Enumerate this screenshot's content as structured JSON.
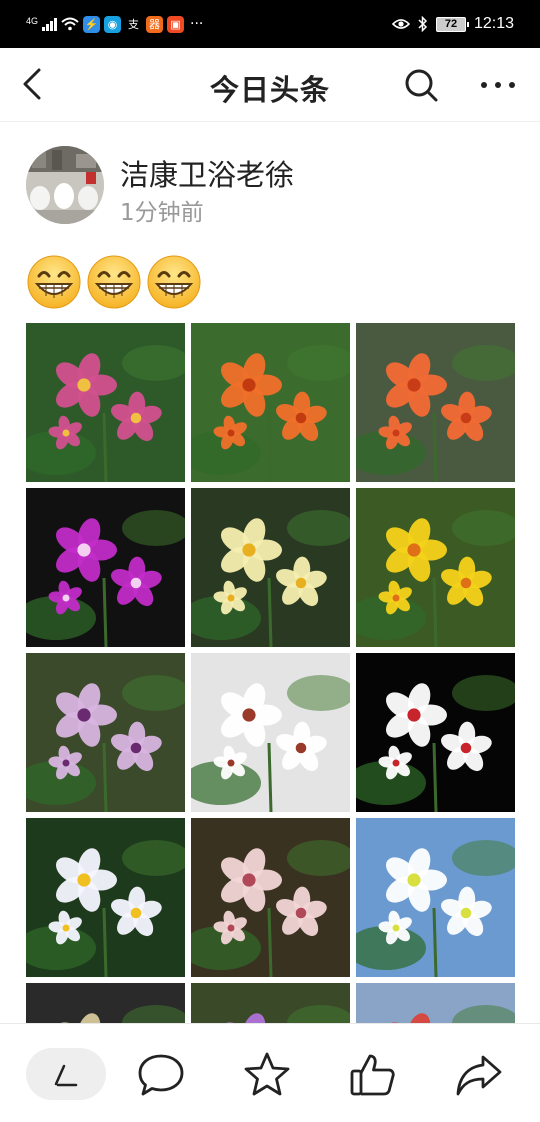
{
  "status_bar": {
    "network": "4G",
    "time": "12:13",
    "battery": "72",
    "overflow": "···",
    "app_icons": [
      {
        "name": "wifi-speed-icon",
        "glyph": "⚡",
        "color": "#2f8fe8"
      },
      {
        "name": "wechat-icon",
        "glyph": "◉",
        "color": "#18a0e0"
      },
      {
        "name": "alipay-icon",
        "glyph": "支",
        "color": "#000000"
      },
      {
        "name": "app-orange-icon",
        "glyph": "器",
        "color": "#f26a1b"
      },
      {
        "name": "app-red-icon",
        "glyph": "▣",
        "color": "#f04a24"
      }
    ]
  },
  "nav": {
    "title": "今日头条"
  },
  "author": {
    "name": "洁康卫浴老徐",
    "time": "1分钟前"
  },
  "post": {
    "emoji": "😁😁😁"
  },
  "gallery": {
    "tiles": [
      {
        "name": "photo-pink-abutilon",
        "bg": "#2e5a2a",
        "flower": "#d2508e",
        "center": "#f0c040"
      },
      {
        "name": "photo-orange-bell-abutilon",
        "bg": "#3c6b2e",
        "flower": "#f0702a",
        "center": "#c23a10"
      },
      {
        "name": "photo-orange-lanterns",
        "bg": "#4a5a40",
        "flower": "#f26a34",
        "center": "#c83c18"
      },
      {
        "name": "photo-magenta-orchid",
        "bg": "#111111",
        "flower": "#c22cc8",
        "center": "#f4d0f0"
      },
      {
        "name": "photo-yellow-zephyranthes",
        "bg": "#2a3a22",
        "flower": "#f6eeb0",
        "center": "#e8b020"
      },
      {
        "name": "photo-yellow-allamanda",
        "bg": "#3b5a24",
        "flower": "#f6d21a",
        "center": "#e07018"
      },
      {
        "name": "photo-passion-flower",
        "bg": "#3a4a2a",
        "flower": "#d8b4e0",
        "center": "#6a2a70"
      },
      {
        "name": "photo-white-spotted-orchid",
        "bg": "#e4e4e4",
        "flower": "#ffffff",
        "center": "#9a3a2a"
      },
      {
        "name": "photo-red-white-orchid",
        "bg": "#050505",
        "flower": "#ffffff",
        "center": "#c8242c"
      },
      {
        "name": "photo-white-iris",
        "bg": "#1e3a1c",
        "flower": "#f6f6ff",
        "center": "#f0c020"
      },
      {
        "name": "photo-pink-slipper-orchid",
        "bg": "#3a3220",
        "flower": "#f2d6d6",
        "center": "#b04858"
      },
      {
        "name": "photo-white-lily-sky",
        "bg": "#6a9ad0",
        "flower": "#ffffff",
        "center": "#d8e040"
      },
      {
        "name": "photo-dark-seedheads",
        "bg": "#2a2a2a",
        "flower": "#d6c89a",
        "center": "#8a7a50"
      },
      {
        "name": "photo-purple-petunia",
        "bg": "#3a4a28",
        "flower": "#b072d8",
        "center": "#8040b0"
      },
      {
        "name": "photo-red-flower-garden",
        "bg": "#8aa4c8",
        "flower": "#d8443a",
        "center": "#7a2a1a"
      }
    ]
  },
  "colors": {
    "text_primary": "#222222",
    "text_secondary": "#999999",
    "divider": "#eeeeee"
  }
}
